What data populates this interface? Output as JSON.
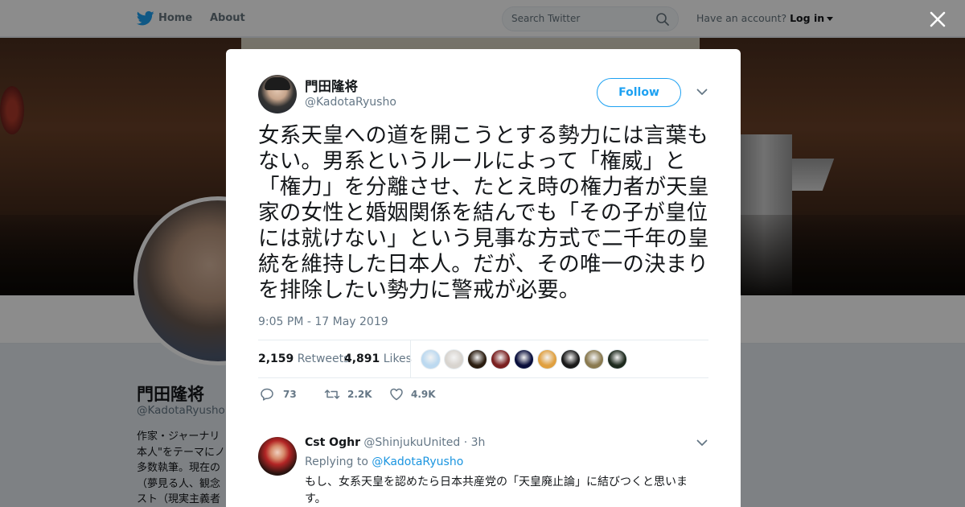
{
  "nav": {
    "home_label": "Home",
    "about_label": "About",
    "search_placeholder": "Search Twitter",
    "have_account": "Have an account?",
    "login_label": "Log in"
  },
  "profile": {
    "name": "門田隆将",
    "handle": "@KadotaRyusho",
    "bio_visible": "作家・ジャーナリ\n本人\"をテーマにノ\n多数執筆。現在の\n（夢見る人、観念\nスト（現実主義者"
  },
  "tweet": {
    "author_name": "門田隆将",
    "author_handle": "@KadotaRyusho",
    "follow_label": "Follow",
    "text": "女系天皇への道を開こうとする勢力には言葉もない。男系というルールによって「権威」と「権力」を分離させ、たとえ時の権力者が天皇家の女性と婚姻関係を結んでも「その子が皇位には就けない」という見事な方式で二千年の皇統を維持した日本人。だが、その唯一の決まりを排除したい勢力に警戒が必要。",
    "timestamp": "9:05 PM - 17 May 2019",
    "retweets_count": "2,159",
    "retweets_label": "Retweets",
    "likes_count": "4,891",
    "likes_label": "Likes",
    "liker_colors": [
      "#bcd9f0",
      "#d8d4cf",
      "#2b1d10",
      "#7a2020",
      "#0a0f3c",
      "#e0a040",
      "#1a1a1a",
      "#8a7a50",
      "#1e2a1e"
    ],
    "actions": {
      "reply_count": "73",
      "retweet_count": "2.2K",
      "like_count": "4.9K"
    }
  },
  "reply": {
    "name": "Cst Oghr",
    "handle": "@ShinjukuUnited",
    "time": "· 3h",
    "replying_to_label": "Replying to",
    "replying_to_handle": "@KadotaRyusho",
    "text": "もし、女系天皇を認めたら日本共産党の「天皇廃止論」に結びつくと思います。"
  },
  "colors": {
    "twitter_blue": "#1da1f2",
    "link_blue": "#1b95e0",
    "secondary_text": "#657786"
  }
}
